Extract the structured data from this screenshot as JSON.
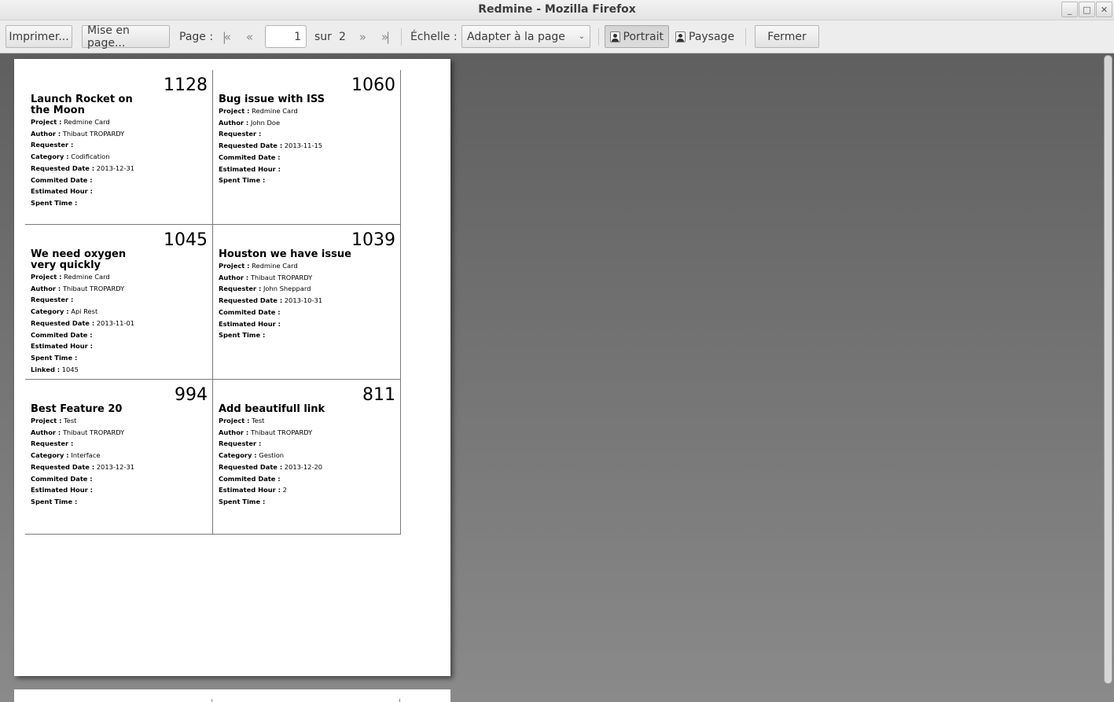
{
  "window": {
    "title": "Redmine - Mozilla Firefox",
    "buttons": [
      "_",
      "□",
      "✕"
    ]
  },
  "toolbar": {
    "print_label": "Imprimer...",
    "page_setup_label": "Mise en page...",
    "page_label": "Page :",
    "current_page": "1",
    "of_label": "sur",
    "total_pages": "2",
    "scale_label": "Échelle :",
    "scale_value": "Adapter à la page",
    "portrait_label": "Portrait",
    "landscape_label": "Paysage",
    "close_label": "Fermer"
  },
  "cards": [
    {
      "number": "1128",
      "title": "Launch Rocket on the Moon",
      "fields": [
        {
          "label": "Project :",
          "value": "Redmine Card"
        },
        {
          "label": "Author :",
          "value": "Thibaut TROPARDY"
        },
        {
          "label": "Requester :",
          "value": ""
        },
        {
          "label": "Category :",
          "value": "Codification"
        },
        {
          "label": "Requested Date :",
          "value": "2013-12-31"
        },
        {
          "label": "Commited Date :",
          "value": ""
        },
        {
          "label": "Estimated Hour :",
          "value": ""
        },
        {
          "label": "Spent Time :",
          "value": ""
        }
      ]
    },
    {
      "number": "1060",
      "title": "Bug issue with ISS",
      "fields": [
        {
          "label": "Project :",
          "value": "Redmine Card"
        },
        {
          "label": "Author :",
          "value": "John Doe"
        },
        {
          "label": "Requester :",
          "value": ""
        },
        {
          "label": "Requested Date :",
          "value": "2013-11-15"
        },
        {
          "label": "Commited Date :",
          "value": ""
        },
        {
          "label": "Estimated Hour :",
          "value": ""
        },
        {
          "label": "Spent Time :",
          "value": ""
        }
      ]
    },
    {
      "number": "1045",
      "title": "We need oxygen very quickly",
      "fields": [
        {
          "label": "Project :",
          "value": "Redmine Card"
        },
        {
          "label": "Author :",
          "value": "Thibaut TROPARDY"
        },
        {
          "label": "Requester :",
          "value": ""
        },
        {
          "label": "Category :",
          "value": "Api Rest"
        },
        {
          "label": "Requested Date :",
          "value": "2013-11-01"
        },
        {
          "label": "Commited Date :",
          "value": ""
        },
        {
          "label": "Estimated Hour :",
          "value": ""
        },
        {
          "label": "Spent Time :",
          "value": ""
        },
        {
          "label": "Linked :",
          "value": "1045"
        }
      ]
    },
    {
      "number": "1039",
      "title": "Houston we have issue",
      "fields": [
        {
          "label": "Project :",
          "value": "Redmine Card"
        },
        {
          "label": "Author :",
          "value": "Thibaut TROPARDY"
        },
        {
          "label": "Requester :",
          "value": "John Sheppard"
        },
        {
          "label": "Requested Date :",
          "value": "2013-10-31"
        },
        {
          "label": "Commited Date :",
          "value": ""
        },
        {
          "label": "Estimated Hour :",
          "value": ""
        },
        {
          "label": "Spent Time :",
          "value": ""
        }
      ]
    },
    {
      "number": "994",
      "title": "Best Feature 20",
      "fields": [
        {
          "label": "Project :",
          "value": "Test"
        },
        {
          "label": "Author :",
          "value": "Thibaut TROPARDY"
        },
        {
          "label": "Requester :",
          "value": ""
        },
        {
          "label": "Category :",
          "value": "Interface"
        },
        {
          "label": "Requested Date :",
          "value": "2013-12-31"
        },
        {
          "label": "Commited Date :",
          "value": ""
        },
        {
          "label": "Estimated Hour :",
          "value": ""
        },
        {
          "label": "Spent Time :",
          "value": ""
        }
      ]
    },
    {
      "number": "811",
      "title": "Add beautifull link",
      "fields": [
        {
          "label": "Project :",
          "value": "Test"
        },
        {
          "label": "Author :",
          "value": "Thibaut TROPARDY"
        },
        {
          "label": "Requester :",
          "value": ""
        },
        {
          "label": "Category :",
          "value": "Gestion"
        },
        {
          "label": "Requested Date :",
          "value": "2013-12-20"
        },
        {
          "label": "Commited Date :",
          "value": ""
        },
        {
          "label": "Estimated Hour :",
          "value": "2"
        },
        {
          "label": "Spent Time :",
          "value": ""
        }
      ]
    }
  ]
}
